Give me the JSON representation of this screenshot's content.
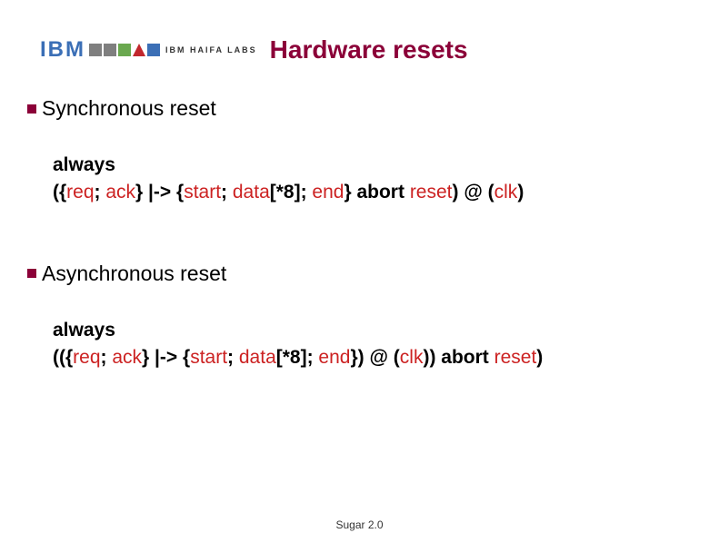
{
  "header": {
    "ibm_text": "IBM",
    "haifa_label": "IBM HAIFA LABS",
    "title": "Hardware resets"
  },
  "sections": [
    {
      "heading": "Synchronous reset",
      "code_lines": [
        [
          {
            "t": "always",
            "cls": "kw"
          }
        ],
        [
          {
            "t": "({",
            "cls": "kw"
          },
          {
            "t": "req",
            "cls": "red"
          },
          {
            "t": "; ",
            "cls": "kw"
          },
          {
            "t": "ack",
            "cls": "red"
          },
          {
            "t": "} |-> {",
            "cls": "kw"
          },
          {
            "t": "start",
            "cls": "red"
          },
          {
            "t": "; ",
            "cls": "kw"
          },
          {
            "t": "data",
            "cls": "red"
          },
          {
            "t": "[*8]; ",
            "cls": "kw"
          },
          {
            "t": "end",
            "cls": "red"
          },
          {
            "t": "} abort ",
            "cls": "kw"
          },
          {
            "t": "reset",
            "cls": "red"
          },
          {
            "t": ") @ (",
            "cls": "kw"
          },
          {
            "t": "clk",
            "cls": "red"
          },
          {
            "t": ")",
            "cls": "kw"
          }
        ]
      ]
    },
    {
      "heading": "Asynchronous reset",
      "code_lines": [
        [
          {
            "t": "always",
            "cls": "kw"
          }
        ],
        [
          {
            "t": "(({",
            "cls": "kw"
          },
          {
            "t": "req",
            "cls": "red"
          },
          {
            "t": "; ",
            "cls": "kw"
          },
          {
            "t": "ack",
            "cls": "red"
          },
          {
            "t": "} |-> {",
            "cls": "kw"
          },
          {
            "t": "start",
            "cls": "red"
          },
          {
            "t": "; ",
            "cls": "kw"
          },
          {
            "t": "data",
            "cls": "red"
          },
          {
            "t": "[*8]; ",
            "cls": "kw"
          },
          {
            "t": "end",
            "cls": "red"
          },
          {
            "t": "}) @ (",
            "cls": "kw"
          },
          {
            "t": "clk",
            "cls": "red"
          },
          {
            "t": ")) abort ",
            "cls": "kw"
          },
          {
            "t": "reset",
            "cls": "red"
          },
          {
            "t": ")",
            "cls": "kw"
          }
        ]
      ]
    }
  ],
  "footer": "Sugar 2.0"
}
